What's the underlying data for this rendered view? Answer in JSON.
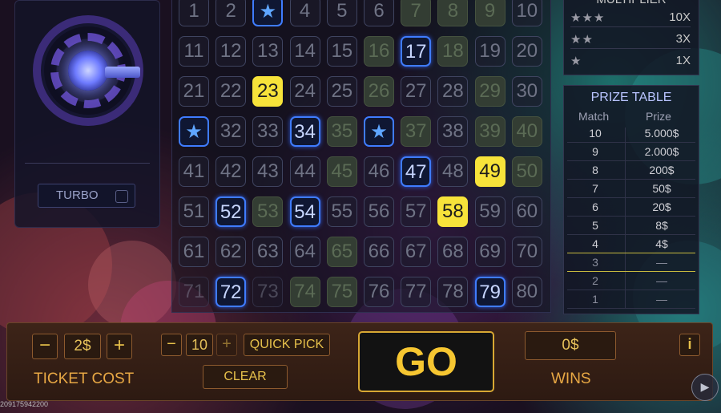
{
  "left_panel": {
    "turbo_label": "TURBO"
  },
  "grid": {
    "cells": [
      {
        "n": "1",
        "s": "normal"
      },
      {
        "n": "2",
        "s": "normal"
      },
      {
        "n": "★",
        "s": "star"
      },
      {
        "n": "4",
        "s": "normal"
      },
      {
        "n": "5",
        "s": "normal"
      },
      {
        "n": "6",
        "s": "normal"
      },
      {
        "n": "7",
        "s": "green"
      },
      {
        "n": "8",
        "s": "green"
      },
      {
        "n": "9",
        "s": "green"
      },
      {
        "n": "10",
        "s": "normal"
      },
      {
        "n": "11",
        "s": "normal"
      },
      {
        "n": "12",
        "s": "normal"
      },
      {
        "n": "13",
        "s": "normal"
      },
      {
        "n": "14",
        "s": "normal"
      },
      {
        "n": "15",
        "s": "normal"
      },
      {
        "n": "16",
        "s": "green"
      },
      {
        "n": "17",
        "s": "blue"
      },
      {
        "n": "18",
        "s": "green"
      },
      {
        "n": "19",
        "s": "normal"
      },
      {
        "n": "20",
        "s": "normal"
      },
      {
        "n": "21",
        "s": "normal"
      },
      {
        "n": "22",
        "s": "normal"
      },
      {
        "n": "23",
        "s": "yellow"
      },
      {
        "n": "24",
        "s": "normal"
      },
      {
        "n": "25",
        "s": "normal"
      },
      {
        "n": "26",
        "s": "green"
      },
      {
        "n": "27",
        "s": "normal"
      },
      {
        "n": "28",
        "s": "normal"
      },
      {
        "n": "29",
        "s": "green"
      },
      {
        "n": "30",
        "s": "normal"
      },
      {
        "n": "★",
        "s": "star"
      },
      {
        "n": "32",
        "s": "normal"
      },
      {
        "n": "33",
        "s": "normal"
      },
      {
        "n": "34",
        "s": "blue"
      },
      {
        "n": "35",
        "s": "green"
      },
      {
        "n": "★",
        "s": "star"
      },
      {
        "n": "37",
        "s": "green"
      },
      {
        "n": "38",
        "s": "normal"
      },
      {
        "n": "39",
        "s": "green"
      },
      {
        "n": "40",
        "s": "green"
      },
      {
        "n": "41",
        "s": "normal"
      },
      {
        "n": "42",
        "s": "normal"
      },
      {
        "n": "43",
        "s": "normal"
      },
      {
        "n": "44",
        "s": "normal"
      },
      {
        "n": "45",
        "s": "green"
      },
      {
        "n": "46",
        "s": "normal"
      },
      {
        "n": "47",
        "s": "blue"
      },
      {
        "n": "48",
        "s": "normal"
      },
      {
        "n": "49",
        "s": "yellow"
      },
      {
        "n": "50",
        "s": "green"
      },
      {
        "n": "51",
        "s": "normal"
      },
      {
        "n": "52",
        "s": "blue"
      },
      {
        "n": "53",
        "s": "green"
      },
      {
        "n": "54",
        "s": "blue"
      },
      {
        "n": "55",
        "s": "normal"
      },
      {
        "n": "56",
        "s": "normal"
      },
      {
        "n": "57",
        "s": "normal"
      },
      {
        "n": "58",
        "s": "yellow"
      },
      {
        "n": "59",
        "s": "normal"
      },
      {
        "n": "60",
        "s": "normal"
      },
      {
        "n": "61",
        "s": "normal"
      },
      {
        "n": "62",
        "s": "normal"
      },
      {
        "n": "63",
        "s": "normal"
      },
      {
        "n": "64",
        "s": "normal"
      },
      {
        "n": "65",
        "s": "green"
      },
      {
        "n": "66",
        "s": "normal"
      },
      {
        "n": "67",
        "s": "normal"
      },
      {
        "n": "68",
        "s": "normal"
      },
      {
        "n": "69",
        "s": "normal"
      },
      {
        "n": "70",
        "s": "normal"
      },
      {
        "n": "71",
        "s": "normal"
      },
      {
        "n": "72",
        "s": "blue"
      },
      {
        "n": "73",
        "s": "normal"
      },
      {
        "n": "74",
        "s": "green"
      },
      {
        "n": "75",
        "s": "green"
      },
      {
        "n": "76",
        "s": "normal"
      },
      {
        "n": "77",
        "s": "normal"
      },
      {
        "n": "78",
        "s": "normal"
      },
      {
        "n": "79",
        "s": "blue"
      },
      {
        "n": "80",
        "s": "normal"
      }
    ]
  },
  "multiplier": {
    "title": "MULTIPLIER",
    "rows": [
      {
        "stars": "★★★",
        "value": "10X"
      },
      {
        "stars": "★★",
        "value": "3X"
      },
      {
        "stars": "★",
        "value": "1X"
      }
    ]
  },
  "prize_table": {
    "title": "PRIZE TABLE",
    "col_match": "Match",
    "col_prize": "Prize",
    "rows": [
      {
        "match": "10",
        "prize": "5.000$"
      },
      {
        "match": "9",
        "prize": "2.000$"
      },
      {
        "match": "8",
        "prize": "200$"
      },
      {
        "match": "7",
        "prize": "50$"
      },
      {
        "match": "6",
        "prize": "20$"
      },
      {
        "match": "5",
        "prize": "8$"
      },
      {
        "match": "4",
        "prize": "4$"
      },
      {
        "match": "3",
        "prize": "—"
      },
      {
        "match": "2",
        "prize": "—"
      },
      {
        "match": "1",
        "prize": "—"
      }
    ]
  },
  "bottom": {
    "ticket_cost_value": "2$",
    "ticket_cost_label": "TICKET COST",
    "minus": "−",
    "plus": "+",
    "pick_count": "10",
    "quick_pick_label": "QUICK PICK",
    "clear_label": "CLEAR",
    "go_label": "GO",
    "wins_value": "0$",
    "wins_label": "WINS",
    "info_label": "i"
  },
  "footer": {
    "ticket_id": "209175942200"
  },
  "colors": {
    "accent": "#e8a844",
    "go": "#f6c631",
    "selected": "#3f7cff",
    "hit": "#f7e33a"
  }
}
